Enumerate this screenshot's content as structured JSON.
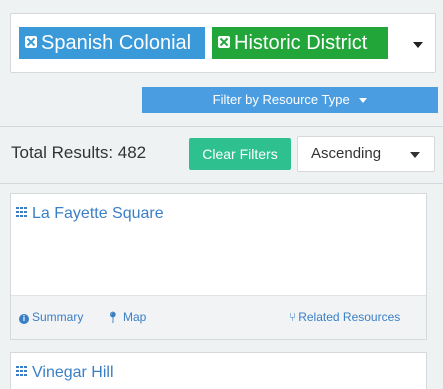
{
  "tags": [
    {
      "label": "Spanish Colonial",
      "color": "#3a9ad9"
    },
    {
      "label": "Historic District",
      "color": "#22a63a"
    }
  ],
  "filter_button": {
    "label": "Filter by Resource Type"
  },
  "results": {
    "total_label": "Total Results: 482"
  },
  "clear_filters": {
    "label": "Clear Filters",
    "color": "#2ec08f"
  },
  "sort_select": {
    "value": "Ascending"
  },
  "cards": [
    {
      "title": "La Fayette Square",
      "links": {
        "summary": "Summary",
        "map": "Map",
        "related": "Related Resources"
      }
    },
    {
      "title": "Vinegar Hill"
    }
  ],
  "icons": {
    "tag_remove": "close-icon",
    "dropdown": "chevron-down-icon",
    "card_type": "grid-icon",
    "summary": "info-icon",
    "map": "map-marker-icon",
    "related": "related-fork-icon"
  }
}
